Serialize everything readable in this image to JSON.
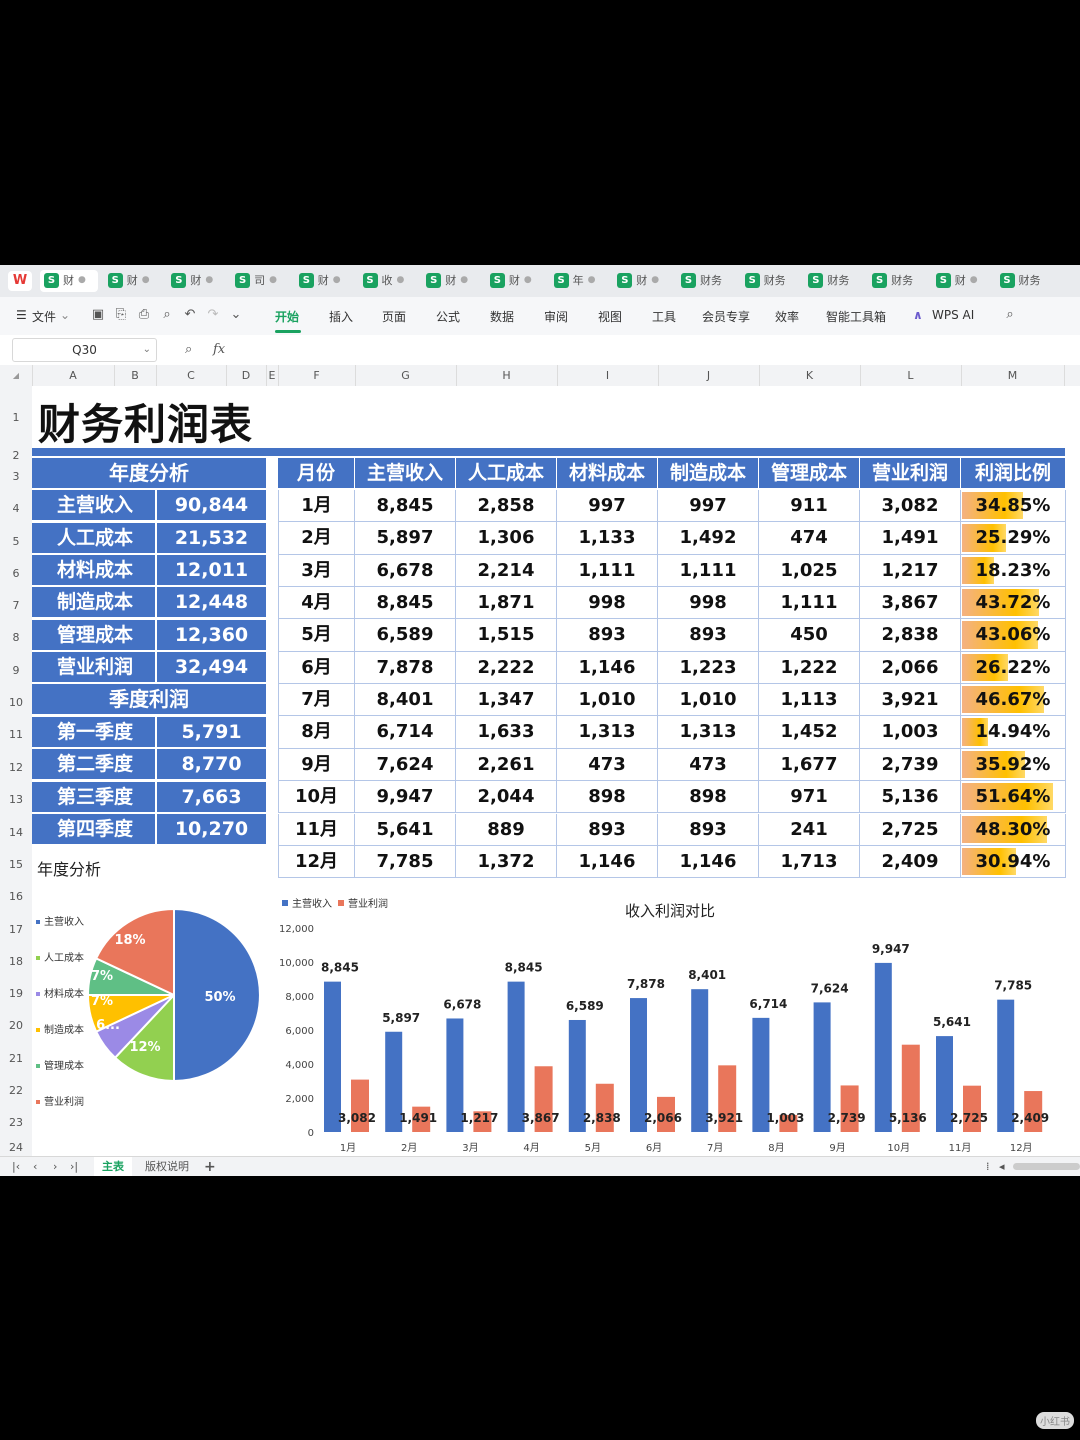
{
  "tabs": [
    {
      "label": "财",
      "active": true
    },
    {
      "label": "财"
    },
    {
      "label": "财"
    },
    {
      "label": "司"
    },
    {
      "label": "财"
    },
    {
      "label": "收"
    },
    {
      "label": "财"
    },
    {
      "label": "财"
    },
    {
      "label": "年"
    },
    {
      "label": "财"
    },
    {
      "label": "财务"
    },
    {
      "label": "财务"
    },
    {
      "label": "财务"
    },
    {
      "label": "财务"
    },
    {
      "label": "财"
    },
    {
      "label": "财务"
    }
  ],
  "toolbar": {
    "file": "文件",
    "menus": [
      "开始",
      "插入",
      "页面",
      "公式",
      "数据",
      "审阅",
      "视图",
      "工具",
      "会员专享",
      "效率",
      "智能工具箱"
    ],
    "ai": "WPS AI"
  },
  "formula": {
    "namebox": "Q30",
    "fx": "fx"
  },
  "columns": [
    "A",
    "B",
    "C",
    "D",
    "E",
    "F",
    "G",
    "H",
    "I",
    "J",
    "K",
    "L",
    "M"
  ],
  "rows": [
    "1",
    "2",
    "3",
    "4",
    "5",
    "6",
    "7",
    "8",
    "9",
    "10",
    "11",
    "12",
    "13",
    "14",
    "15",
    "16",
    "17",
    "18",
    "19",
    "20",
    "21",
    "22",
    "23",
    "24"
  ],
  "title": "财务利润表",
  "annual": {
    "header": "年度分析",
    "items": [
      {
        "label": "主营收入",
        "value": "90,844"
      },
      {
        "label": "人工成本",
        "value": "21,532"
      },
      {
        "label": "材料成本",
        "value": "12,011"
      },
      {
        "label": "制造成本",
        "value": "12,448"
      },
      {
        "label": "管理成本",
        "value": "12,360"
      },
      {
        "label": "营业利润",
        "value": "32,494"
      }
    ]
  },
  "quarterly": {
    "header": "季度利润",
    "items": [
      {
        "label": "第一季度",
        "value": "5,791"
      },
      {
        "label": "第二季度",
        "value": "8,770"
      },
      {
        "label": "第三季度",
        "value": "7,663"
      },
      {
        "label": "第四季度",
        "value": "10,270"
      }
    ]
  },
  "table": {
    "headers": [
      "月份",
      "主营收入",
      "人工成本",
      "材料成本",
      "制造成本",
      "管理成本",
      "营业利润",
      "利润比例"
    ],
    "rows": [
      [
        "1月",
        "8,845",
        "2,858",
        "997",
        "997",
        "911",
        "3,082",
        "34.85%"
      ],
      [
        "2月",
        "5,897",
        "1,306",
        "1,133",
        "1,492",
        "474",
        "1,491",
        "25.29%"
      ],
      [
        "3月",
        "6,678",
        "2,214",
        "1,111",
        "1,111",
        "1,025",
        "1,217",
        "18.23%"
      ],
      [
        "4月",
        "8,845",
        "1,871",
        "998",
        "998",
        "1,111",
        "3,867",
        "43.72%"
      ],
      [
        "5月",
        "6,589",
        "1,515",
        "893",
        "893",
        "450",
        "2,838",
        "43.06%"
      ],
      [
        "6月",
        "7,878",
        "2,222",
        "1,146",
        "1,223",
        "1,222",
        "2,066",
        "26.22%"
      ],
      [
        "7月",
        "8,401",
        "1,347",
        "1,010",
        "1,010",
        "1,113",
        "3,921",
        "46.67%"
      ],
      [
        "8月",
        "6,714",
        "1,633",
        "1,313",
        "1,313",
        "1,452",
        "1,003",
        "14.94%"
      ],
      [
        "9月",
        "7,624",
        "2,261",
        "473",
        "473",
        "1,677",
        "2,739",
        "35.92%"
      ],
      [
        "10月",
        "9,947",
        "2,044",
        "898",
        "898",
        "971",
        "5,136",
        "51.64%"
      ],
      [
        "11月",
        "5,641",
        "889",
        "893",
        "893",
        "241",
        "2,725",
        "48.30%"
      ],
      [
        "12月",
        "7,785",
        "1,372",
        "1,146",
        "1,146",
        "1,713",
        "2,409",
        "30.94%"
      ]
    ],
    "ratios": [
      34.85,
      25.29,
      18.23,
      43.72,
      43.06,
      26.22,
      46.67,
      14.94,
      35.92,
      51.64,
      48.3,
      30.94
    ]
  },
  "chart_data": [
    {
      "type": "pie",
      "title": "年度分析",
      "categories": [
        "主营收入",
        "人工成本",
        "材料成本",
        "制造成本",
        "管理成本",
        "营业利润"
      ],
      "values": [
        50,
        12,
        6,
        7,
        7,
        18
      ],
      "labels": [
        "50%",
        "12%",
        "6...",
        "7%",
        "7%",
        "18%"
      ],
      "colors": [
        "#4472c4",
        "#92d050",
        "#9b8ae6",
        "#ffc000",
        "#5fbf85",
        "#e9765b"
      ],
      "legend": "left"
    },
    {
      "type": "bar",
      "title": "收入利润对比",
      "categories": [
        "1月",
        "2月",
        "3月",
        "4月",
        "5月",
        "6月",
        "7月",
        "8月",
        "9月",
        "10月",
        "11月",
        "12月"
      ],
      "series": [
        {
          "name": "主营收入",
          "values": [
            8845,
            5897,
            6678,
            8845,
            6589,
            7878,
            8401,
            6714,
            7624,
            9947,
            5641,
            7785
          ],
          "labels": [
            "8,845",
            "5,897",
            "6,678",
            "8,845",
            "6,589",
            "7,878",
            "8,401",
            "6,714",
            "7,624",
            "9,947",
            "5,641",
            "7,785"
          ],
          "color": "#4472c4"
        },
        {
          "name": "营业利润",
          "values": [
            3082,
            1491,
            1217,
            3867,
            2838,
            2066,
            3921,
            1003,
            2739,
            5136,
            2725,
            2409
          ],
          "labels": [
            "3,082",
            "1,491",
            "1,217",
            "3,867",
            "2,838",
            "2,066",
            "3,921",
            "1,003",
            "2,739",
            "5,136",
            "2,725",
            "2,409"
          ],
          "color": "#e9765b"
        }
      ],
      "yticks": [
        "0",
        "2,000",
        "4,000",
        "6,000",
        "8,000",
        "10,000",
        "12,000"
      ],
      "ylim": [
        0,
        12000
      ],
      "legend": "top-left"
    }
  ],
  "sheets": {
    "tabs": [
      "主表",
      "版权说明"
    ],
    "add": "+"
  },
  "watermark": "小红书"
}
